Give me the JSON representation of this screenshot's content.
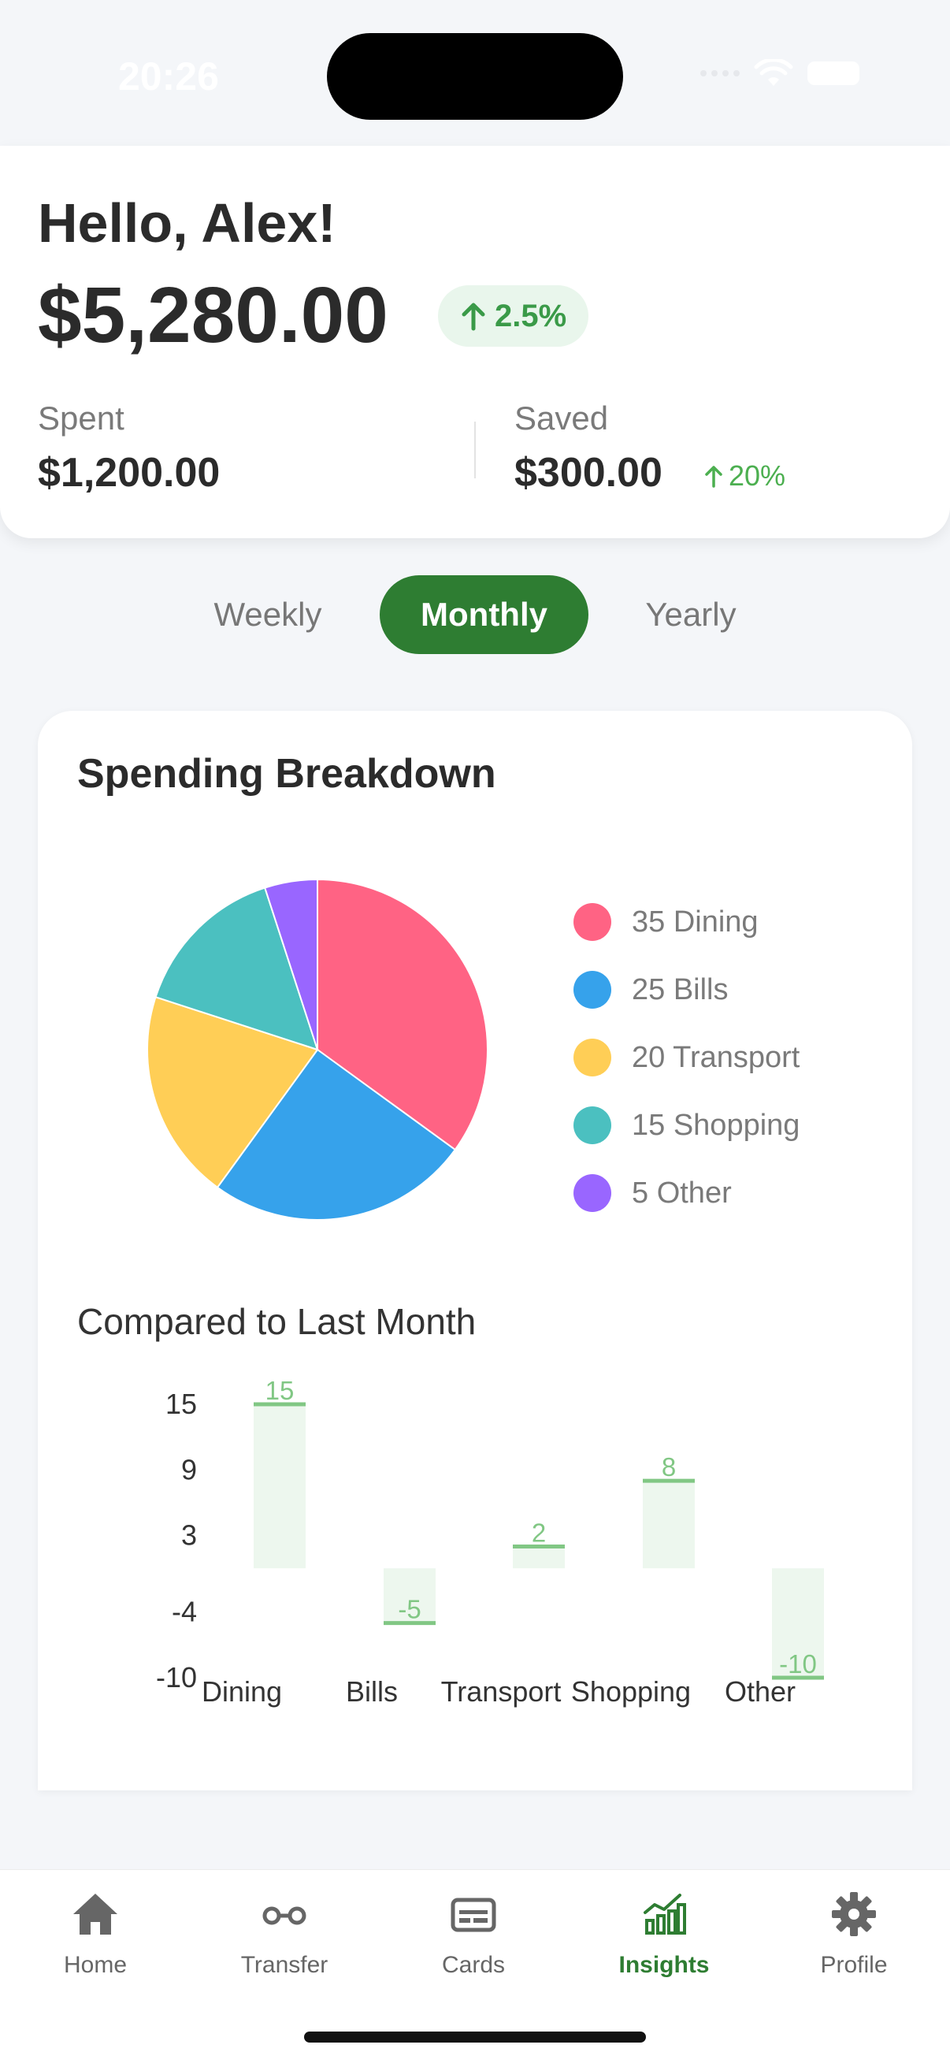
{
  "status_bar": {
    "time": "20:26"
  },
  "header": {
    "greeting": "Hello, Alex!",
    "balance": "$5,280.00",
    "balance_change": "2.5%",
    "spent_label": "Spent",
    "spent_value": "$1,200.00",
    "saved_label": "Saved",
    "saved_value": "$300.00",
    "saved_change": "20%"
  },
  "period_tabs": [
    {
      "label": "Weekly",
      "active": false
    },
    {
      "label": "Monthly",
      "active": true
    },
    {
      "label": "Yearly",
      "active": false
    }
  ],
  "breakdown": {
    "title": "Spending Breakdown",
    "compare_title": "Compared to Last Month"
  },
  "chart_data": [
    {
      "type": "pie",
      "categories": [
        "Dining",
        "Bills",
        "Transport",
        "Shopping",
        "Other"
      ],
      "values": [
        35,
        25,
        20,
        15,
        5
      ],
      "legend": [
        "35 Dining",
        "25 Bills",
        "20 Transport",
        "15 Shopping",
        "5 Other"
      ],
      "colors": [
        "#ff6384",
        "#36a2eb",
        "#ffce56",
        "#4bc0c0",
        "#9966ff"
      ],
      "legend_position": "right"
    },
    {
      "type": "bar",
      "categories": [
        "Dining",
        "Bills",
        "Transport",
        "Shopping",
        "Other"
      ],
      "values": [
        15,
        -5,
        2,
        8,
        -10
      ],
      "data_labels": [
        "15",
        "-5",
        "2",
        "8",
        "-10"
      ],
      "y_ticks": [
        "15",
        "9",
        "3",
        "-4",
        "-10"
      ],
      "ylim": [
        -10,
        15
      ],
      "bar_fill": "#edf7ee",
      "value_line_color": "#81c784"
    }
  ],
  "bottom_nav": [
    {
      "label": "Home",
      "icon": "home-icon",
      "active": false
    },
    {
      "label": "Transfer",
      "icon": "transfer-icon",
      "active": false
    },
    {
      "label": "Cards",
      "icon": "card-icon",
      "active": false
    },
    {
      "label": "Insights",
      "icon": "insights-icon",
      "active": true
    },
    {
      "label": "Profile",
      "icon": "gear-icon",
      "active": false
    }
  ],
  "colors": {
    "accent": "#2e7d32",
    "positive": "#4caf50",
    "badge_bg": "#e9f6ec"
  }
}
